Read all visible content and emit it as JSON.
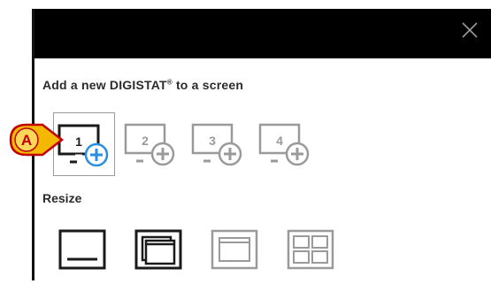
{
  "dialog": {
    "heading_text": "Add a new DIGISTAT",
    "heading_reg": "®",
    "heading_suffix": " to a screen",
    "resize_label": "Resize"
  },
  "screens": [
    {
      "number": "1",
      "state": "selected",
      "icon": "monitor-add-icon"
    },
    {
      "number": "2",
      "state": "disabled",
      "icon": "monitor-add-icon"
    },
    {
      "number": "3",
      "state": "disabled",
      "icon": "monitor-add-icon"
    },
    {
      "number": "4",
      "state": "disabled",
      "icon": "monitor-add-icon"
    }
  ],
  "resize_options": [
    {
      "icon": "minimize-icon",
      "state": "enabled"
    },
    {
      "icon": "restore-icon",
      "state": "enabled"
    },
    {
      "icon": "maximize-icon",
      "state": "disabled"
    },
    {
      "icon": "tile-grid-icon",
      "state": "disabled"
    }
  ],
  "callout": {
    "letter": "A",
    "fill": "#f5b800",
    "text_color": "#c00000"
  },
  "colors": {
    "titlebar": "#000000",
    "accent": "#2a8ee0",
    "icon_dark": "#1a1a1a",
    "icon_disabled": "#9a9a9a"
  }
}
